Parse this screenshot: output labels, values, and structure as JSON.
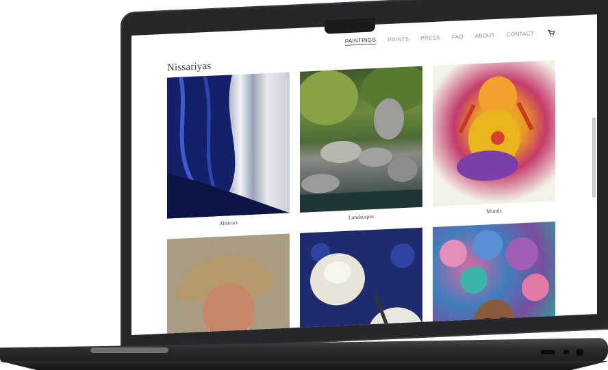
{
  "site": {
    "logo": "Nissariyas",
    "nav": [
      {
        "label": "PAINTINGS",
        "active": true
      },
      {
        "label": "PRINTS"
      },
      {
        "label": "PRESS"
      },
      {
        "label": "FAQ"
      },
      {
        "label": "ABOUT"
      },
      {
        "label": "CONTACT"
      }
    ],
    "cart_icon": "shopping-cart-icon"
  },
  "gallery": [
    {
      "caption": "Abstract",
      "image": "blue waterfall abstract painting"
    },
    {
      "caption": "Landscapes",
      "image": "forest stream with rocks painting"
    },
    {
      "caption": "Murals",
      "image": "colorful Ganesha mural"
    },
    {
      "caption": "",
      "image": "portrait of old man in hat"
    },
    {
      "caption": "",
      "image": "teapot still life painting"
    },
    {
      "caption": "",
      "image": "woman with hydrangea hair painting"
    }
  ],
  "colors": {
    "laptop_body": "#26272b",
    "page_bg": "#ffffff",
    "nav_text": "#8c8c8c"
  }
}
